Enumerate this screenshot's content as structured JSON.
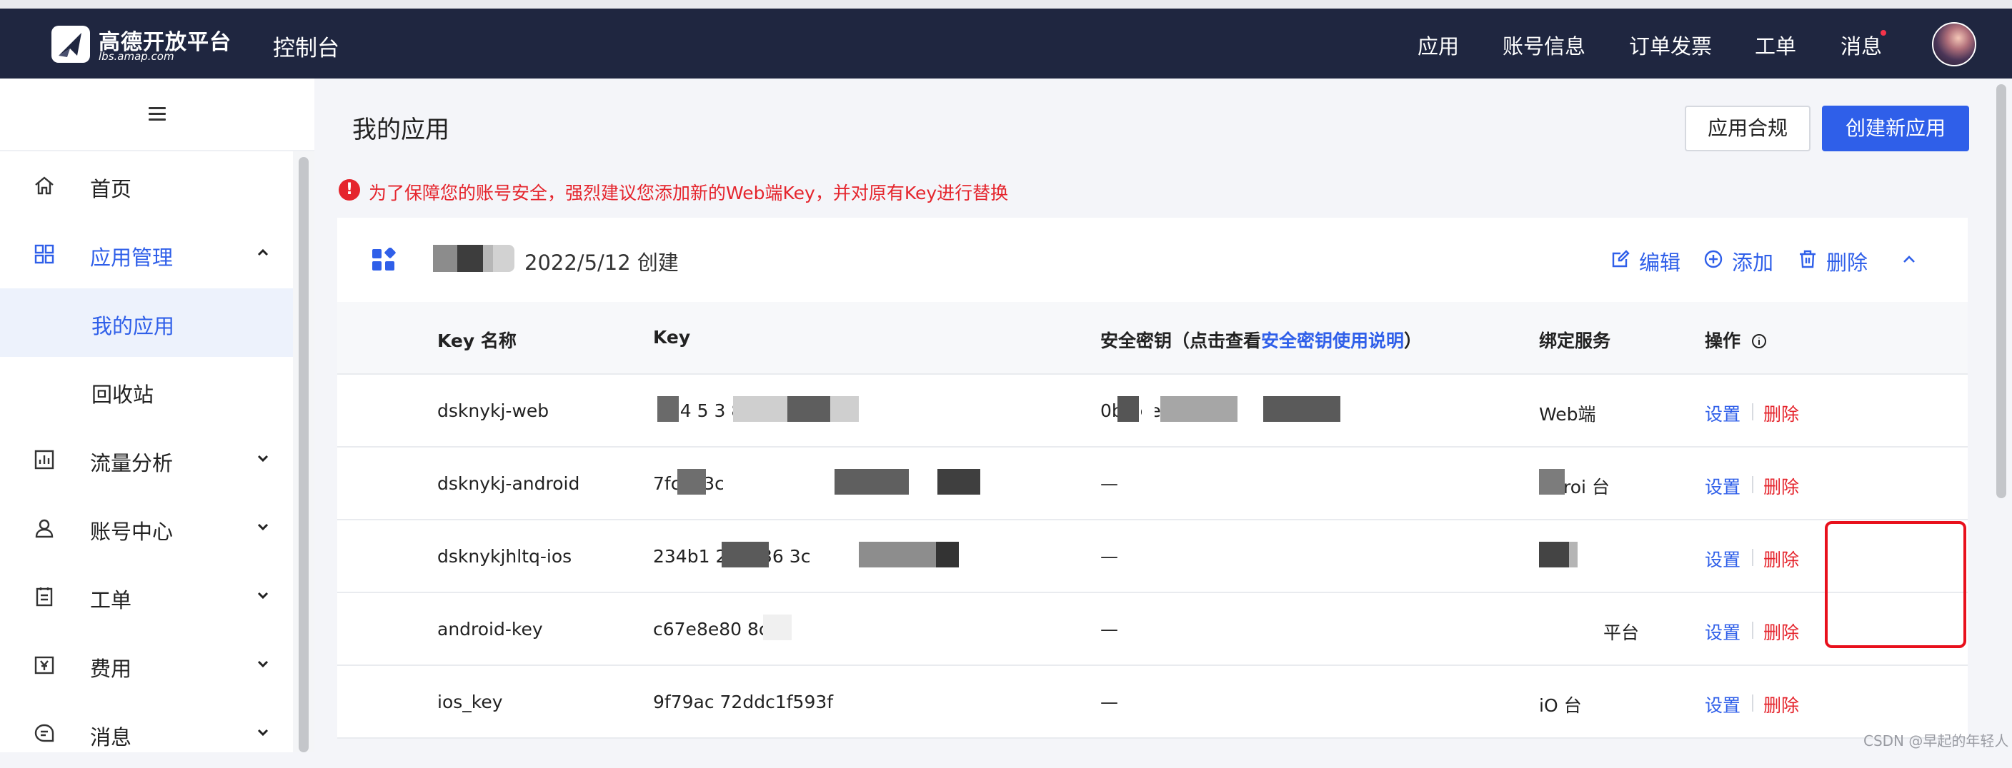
{
  "header": {
    "brand_name": "高德开放平台",
    "brand_sub": "lbs.amap.com",
    "console_title": "控制台",
    "nav": [
      "应用",
      "账号信息",
      "订单发票",
      "工单",
      "消息"
    ]
  },
  "sidebar": {
    "items": [
      {
        "label": "首页",
        "icon": "home-icon"
      },
      {
        "label": "应用管理",
        "icon": "grid-icon"
      },
      {
        "label": "流量分析",
        "icon": "chart-icon"
      },
      {
        "label": "账号中心",
        "icon": "user-icon"
      },
      {
        "label": "工单",
        "icon": "ticket-icon"
      },
      {
        "label": "费用",
        "icon": "yen-icon"
      },
      {
        "label": "消息",
        "icon": "message-icon"
      }
    ],
    "subitems": [
      "我的应用",
      "回收站"
    ]
  },
  "main": {
    "title": "我的应用",
    "compliance_button": "应用合规",
    "create_button": "创建新应用",
    "warning": "为了保障您的账号安全，强烈建议您添加新的Web端Key，并对原有Key进行替换"
  },
  "card": {
    "created": "2022/5/12 创建",
    "actions": {
      "edit": "编辑",
      "add": "添加",
      "delete": "删除"
    }
  },
  "table": {
    "headers": {
      "key_name": "Key 名称",
      "key": "Key",
      "secret_prefix": "安全密钥（点击查看",
      "secret_link": "安全密钥使用说明",
      "secret_suffix": "）",
      "service": "绑定服务",
      "ops": "操作"
    },
    "rows": [
      {
        "name": "dsknykj-web",
        "key": "274 5 3 8b5e 2e",
        "secret": "0b 2ceeb121",
        "service": "Web端"
      },
      {
        "name": "dsknykj-android",
        "key": "7fc 7 3c9 de",
        "secret": "—",
        "service": "roi 台"
      },
      {
        "name": "dsknykjhltq-ios",
        "key": "234b1 262d36 3c",
        "secret": "—",
        "service": ""
      },
      {
        "name": "android-key",
        "key": "c67e8e80 8c",
        "secret": "—",
        "service": "平台"
      },
      {
        "name": "ios_key",
        "key": "9f79ac 72ddc1f593f",
        "secret": "—",
        "service": "iO 台"
      }
    ],
    "op_set": "设置",
    "op_delete": "删除"
  },
  "watermark": "CSDN @早起的年轻人"
}
